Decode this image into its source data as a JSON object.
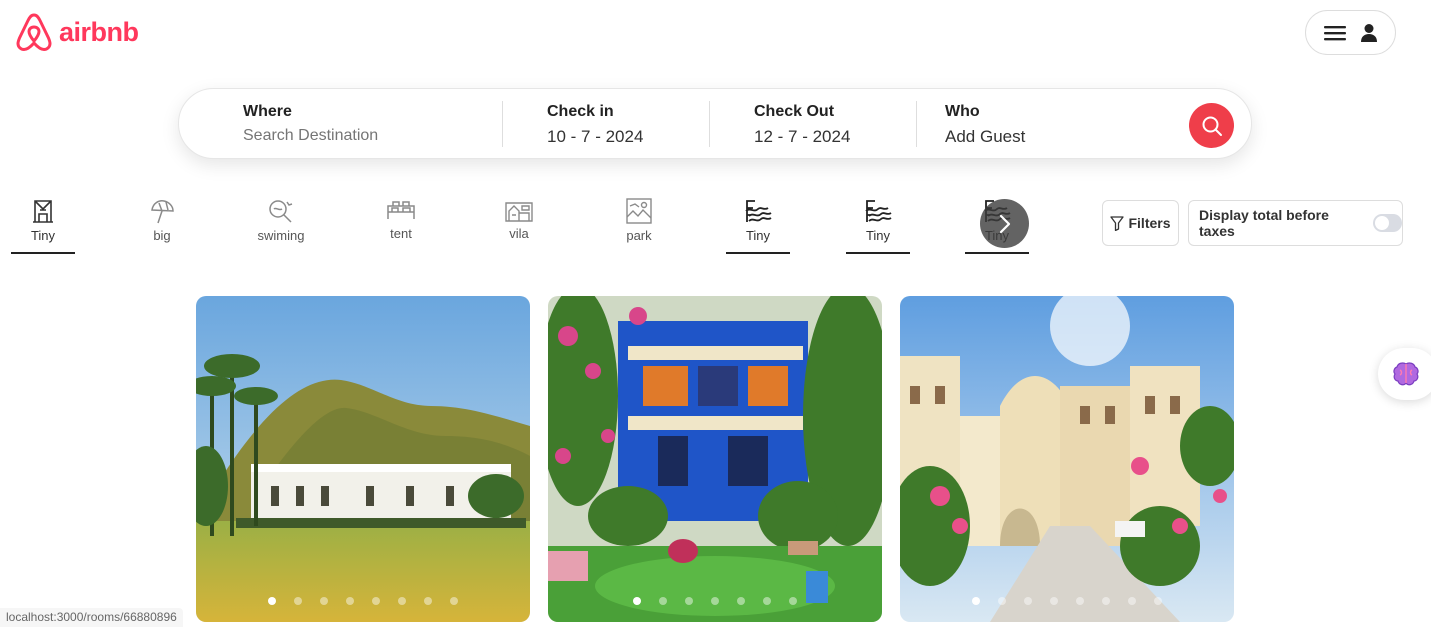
{
  "header": {
    "logo_text": "airbnb",
    "brand_color": "#ff385c",
    "menu_icon": "hamburger-icon",
    "user_icon": "user-icon"
  },
  "search": {
    "where_label": "Where",
    "where_placeholder": "Search Destination",
    "checkin_label": "Check in",
    "checkin_value": "10 - 7 - 2024",
    "checkout_label": "Check Out",
    "checkout_value": "12 - 7 - 2024",
    "who_label": "Who",
    "who_value": "Add Guest",
    "button_icon": "search-icon",
    "button_color": "#ef3e4a"
  },
  "categories": [
    {
      "label": "Tiny",
      "icon": "tiny-house-icon",
      "active": true
    },
    {
      "label": "big",
      "icon": "beach-umbrella-icon",
      "active": false
    },
    {
      "label": "swiming",
      "icon": "swimming-icon",
      "active": false
    },
    {
      "label": "tent",
      "icon": "tent-icon",
      "active": false
    },
    {
      "label": "vila",
      "icon": "villa-icon",
      "active": false
    },
    {
      "label": "park",
      "icon": "park-icon",
      "active": false
    },
    {
      "label": "Tiny",
      "icon": "pool-waves-icon",
      "active": true
    },
    {
      "label": "Tiny",
      "icon": "pool-waves-icon",
      "active": true
    },
    {
      "label": "Tiny",
      "icon": "pool-waves-icon",
      "active": true
    }
  ],
  "filters": {
    "filters_label": "Filters",
    "taxes_label": "Display total before taxes",
    "taxes_toggle_on": false
  },
  "listings": [
    {
      "photo": "hill-villa",
      "slide_count": 8,
      "active_slide": 1
    },
    {
      "photo": "blue-house-garden",
      "slide_count": 7,
      "active_slide": 1
    },
    {
      "photo": "heritage-courtyard",
      "slide_count": 8,
      "active_slide": 1
    }
  ],
  "status_bar": {
    "url": "localhost:3000/rooms/66880896"
  }
}
